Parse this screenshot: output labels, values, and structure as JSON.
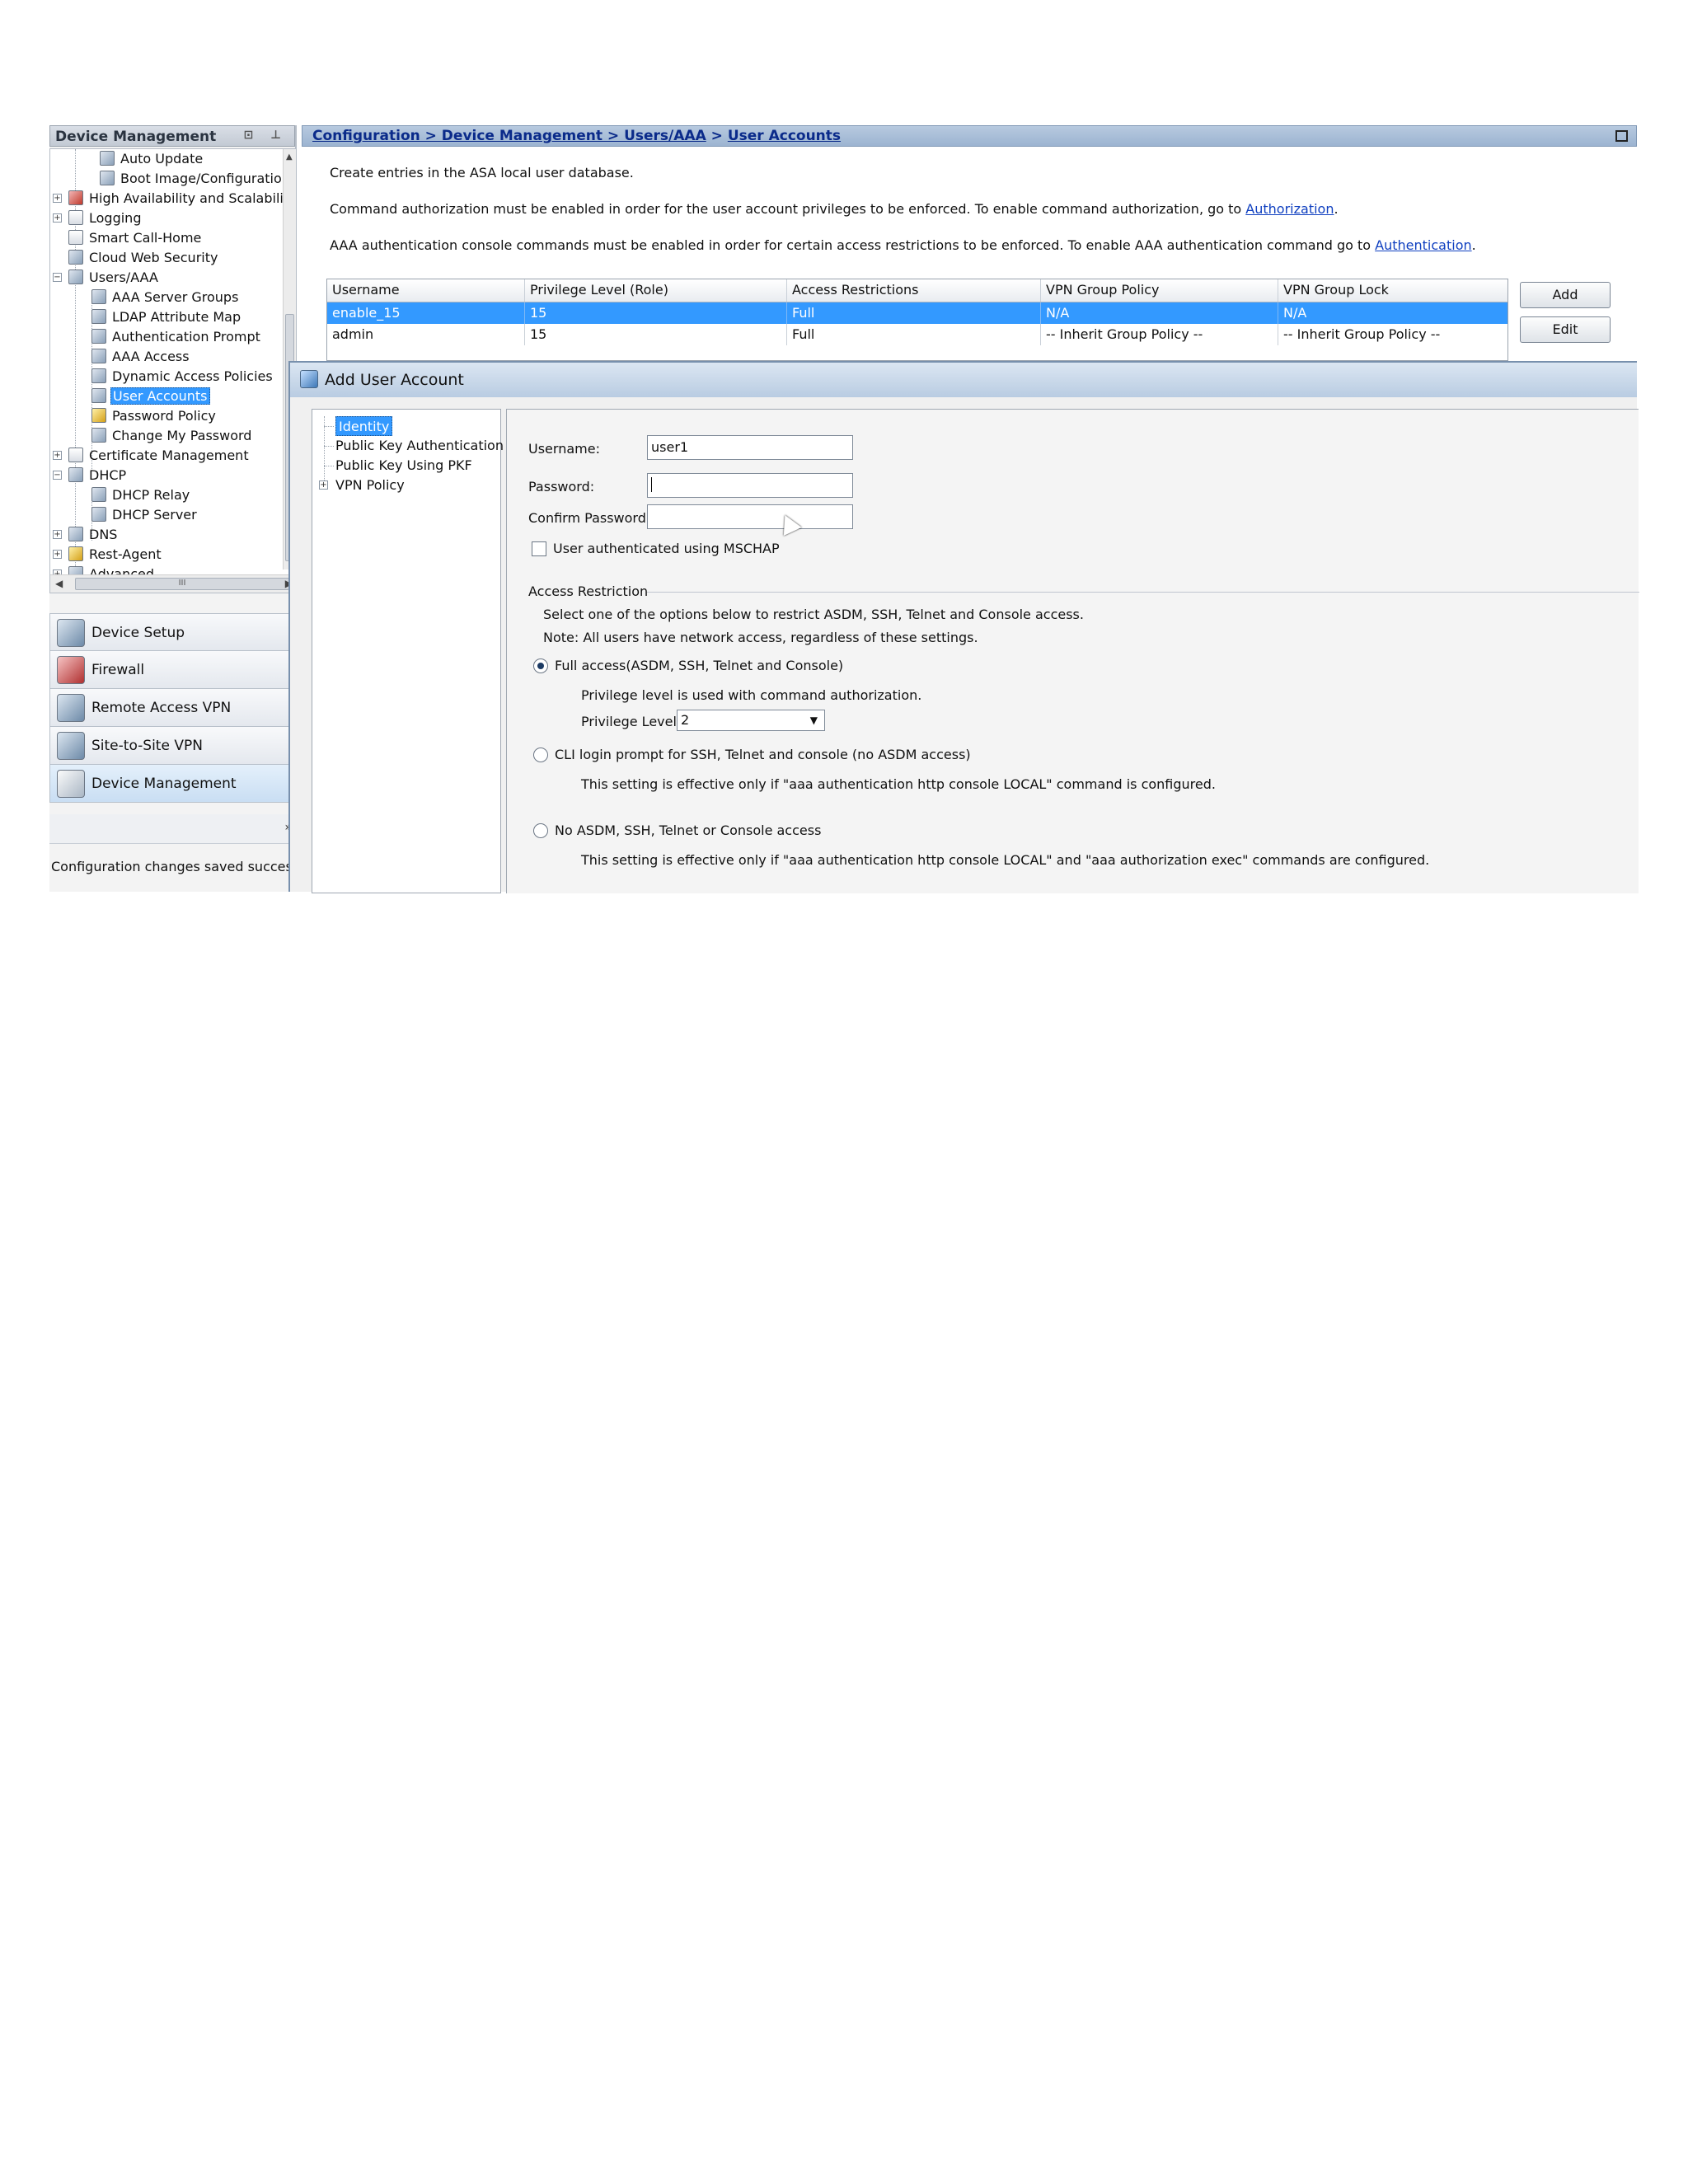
{
  "left_panel": {
    "title": "Device Management",
    "header_icons": "⊡ ⊥",
    "tree": [
      {
        "label": "Auto Update",
        "level": 2
      },
      {
        "label": "Boot Image/Configuration",
        "level": 2
      },
      {
        "label": "High Availability and Scalability",
        "level": 1,
        "expander": "+"
      },
      {
        "label": "Logging",
        "level": 1,
        "expander": "+"
      },
      {
        "label": "Smart Call-Home",
        "level": 1
      },
      {
        "label": "Cloud Web Security",
        "level": 1
      },
      {
        "label": "Users/AAA",
        "level": 1,
        "expander": "−"
      },
      {
        "label": "AAA Server Groups",
        "level": 2
      },
      {
        "label": "LDAP Attribute Map",
        "level": 2
      },
      {
        "label": "Authentication Prompt",
        "level": 2
      },
      {
        "label": "AAA Access",
        "level": 2
      },
      {
        "label": "Dynamic Access Policies",
        "level": 2
      },
      {
        "label": "User Accounts",
        "level": 2,
        "selected": true
      },
      {
        "label": "Password Policy",
        "level": 2
      },
      {
        "label": "Change My Password",
        "level": 2
      },
      {
        "label": "Certificate Management",
        "level": 1,
        "expander": "+"
      },
      {
        "label": "DHCP",
        "level": 1,
        "expander": "−"
      },
      {
        "label": "DHCP Relay",
        "level": 2
      },
      {
        "label": "DHCP Server",
        "level": 2
      },
      {
        "label": "DNS",
        "level": 1,
        "expander": "+"
      },
      {
        "label": "Rest-Agent",
        "level": 1,
        "expander": "+"
      },
      {
        "label": "Advanced",
        "level": 1,
        "expander": "+"
      }
    ],
    "hscroll_grip": "III",
    "nav_buttons": [
      {
        "label": "Device Setup"
      },
      {
        "label": "Firewall"
      },
      {
        "label": "Remote Access VPN"
      },
      {
        "label": "Site-to-Site VPN"
      },
      {
        "label": "Device Management",
        "active": true
      }
    ],
    "nav_more": "»",
    "status": "Configuration changes saved successfully."
  },
  "main": {
    "breadcrumb": {
      "path_link": "Configuration > Device Management > Users/AAA",
      "separator": " > ",
      "current_link": "User Accounts"
    },
    "info1": "Create entries in the ASA local user database.",
    "info2_text": "Command authorization must be enabled in order for the user account privileges to be enforced. To enable command authorization, go to ",
    "info2_link": "Authorization",
    "info3_text": "AAA authentication console commands must be enabled in order for certain access restrictions to be enforced. To enable AAA authentication command go to ",
    "info3_link": "Authentication",
    "period": ".",
    "table": {
      "columns": [
        "Username",
        "Privilege Level (Role)",
        "Access Restrictions",
        "VPN Group Policy",
        "VPN Group Lock"
      ],
      "rows": [
        [
          "enable_15",
          "15",
          "Full",
          "N/A",
          "N/A"
        ],
        [
          "admin",
          "15",
          "Full",
          "-- Inherit Group Policy --",
          "-- Inherit Group Policy --"
        ]
      ]
    },
    "add_button": "Add",
    "edit_button": "Edit"
  },
  "dialog": {
    "title": "Add User Account",
    "nav": [
      "Identity",
      "Public Key Authentication",
      "Public Key Using PKF",
      "VPN Policy"
    ],
    "username_label": "Username:",
    "username_value": "user1",
    "password_label": "Password:",
    "confirm_label": "Confirm Password:",
    "mschap_label": "User authenticated using MSCHAP",
    "access_restriction_label": "Access Restriction",
    "access_desc": "Select one of the options below to restrict ASDM, SSH, Telnet and Console access.",
    "access_note": "Note: All users have network access, regardless of these settings.",
    "opt_full": "Full access(ASDM, SSH, Telnet and Console)",
    "opt_full_note": "Privilege level is used with command authorization.",
    "privilege_label": "Privilege Level:",
    "privilege_value": "2",
    "opt_cli": "CLI login prompt for SSH, Telnet and console (no ASDM access)",
    "opt_cli_note": "This setting is effective only if \"aaa authentication http console LOCAL\" command is configured.",
    "opt_none": "No ASDM, SSH, Telnet or Console access",
    "opt_none_note": "This setting is effective only if \"aaa authentication http console LOCAL\" and \"aaa authorization exec\" commands are configured."
  }
}
